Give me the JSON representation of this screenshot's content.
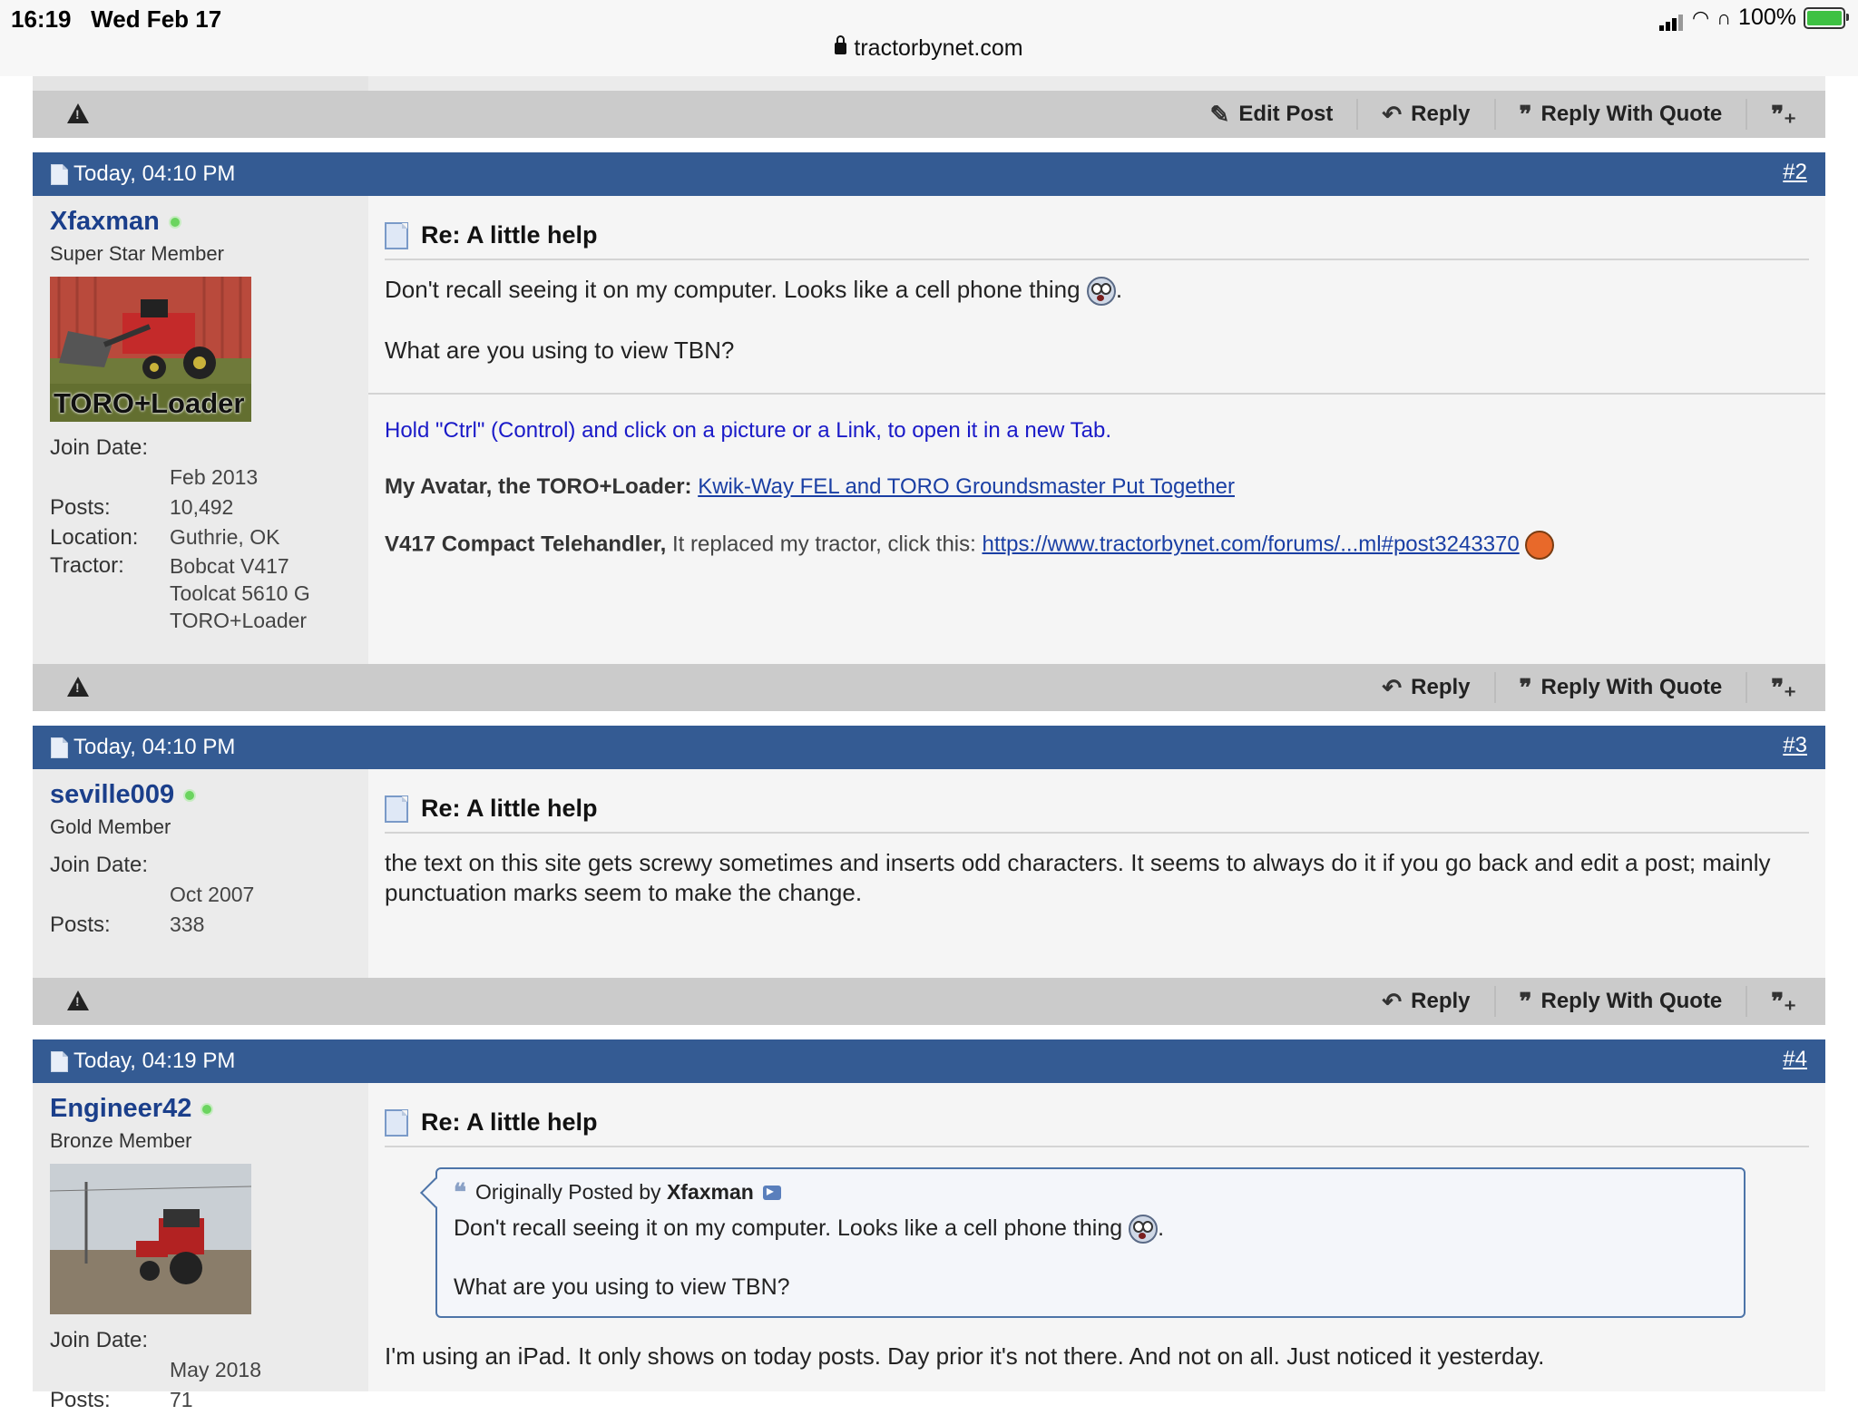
{
  "status_bar": {
    "time": "16:19",
    "date": "Wed Feb 17",
    "battery": "100%",
    "url": "tractorbynet.com"
  },
  "actions": {
    "edit_post": "Edit Post",
    "reply": "Reply",
    "reply_with_quote": "Reply With Quote"
  },
  "posts": [
    {
      "date": "Today, 04:10 PM",
      "number": "#2",
      "username": "Xfaxman",
      "user_title": "Super Star Member",
      "avatar_caption": "TORO+Loader",
      "join_label": "Join Date:",
      "join_date": "Feb 2013",
      "posts_label": "Posts:",
      "posts": "10,492",
      "location_label": "Location:",
      "location": "Guthrie, OK",
      "tractor_label": "Tractor:",
      "tractor": [
        "Bobcat V417",
        "Toolcat 5610 G",
        "TORO+Loader"
      ],
      "title": "Re: A little help",
      "body_1": "Don't recall seeing it on my computer. Looks like a cell phone thing",
      "body_2": "What are you using to view TBN?",
      "sig_line1": "Hold \"Ctrl\" (Control) and click on a picture or a Link, to open it in a new Tab.",
      "sig_avatar_label": "My Avatar, the TORO+Loader:",
      "sig_avatar_link": "Kwik-Way FEL and TORO Groundsmaster Put Together",
      "sig_v417_label": "V417 Compact Telehandler,",
      "sig_v417_text": "It replaced my tractor, click this:",
      "sig_v417_link": "https://www.tractorbynet.com/forums/...ml#post3243370"
    },
    {
      "date": "Today, 04:10 PM",
      "number": "#3",
      "username": "seville009",
      "user_title": "Gold Member",
      "join_label": "Join Date:",
      "join_date": "Oct 2007",
      "posts_label": "Posts:",
      "posts": "338",
      "title": "Re: A little help",
      "body_1": "the text on this site gets screwy sometimes and inserts odd characters. It seems to always do it if you go back and edit a post; mainly punctuation marks seem to make the change."
    },
    {
      "date": "Today, 04:19 PM",
      "number": "#4",
      "username": "Engineer42",
      "user_title": "Bronze Member",
      "join_label": "Join Date:",
      "join_date": "May 2018",
      "posts_label": "Posts:",
      "posts": "71",
      "title": "Re: A little help",
      "quote_prefix": "Originally Posted by",
      "quote_author": "Xfaxman",
      "quote_1": "Don't recall seeing it on my computer. Looks like a cell phone thing",
      "quote_2": "What are you using to view TBN?",
      "body_1": "I'm using an iPad. It only shows on today posts. Day prior it's not there. And not on all. Just noticed it yesterday."
    }
  ]
}
